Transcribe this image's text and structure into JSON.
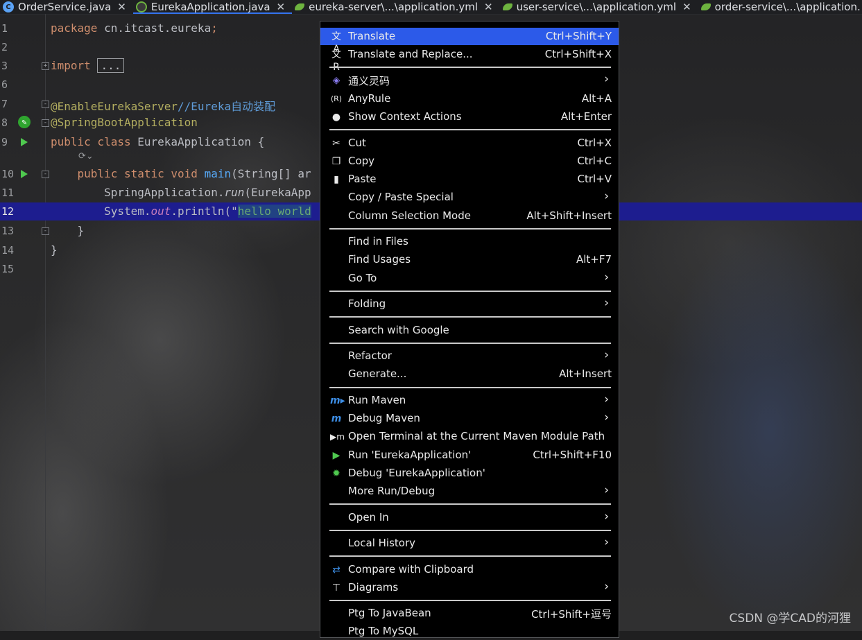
{
  "tabs": [
    {
      "label": "OrderService.java",
      "icon": "class-c-icon",
      "active": false
    },
    {
      "label": "EurekaApplication.java",
      "icon": "spring-class-icon",
      "active": true
    },
    {
      "label": "eureka-server\\...\\application.yml",
      "icon": "spring-leaf-icon",
      "active": false
    },
    {
      "label": "user-service\\...\\application.yml",
      "icon": "spring-leaf-icon",
      "active": false
    },
    {
      "label": "order-service\\...\\application.",
      "icon": "spring-leaf-icon",
      "active": false
    }
  ],
  "editor": {
    "line_numbers": [
      "1",
      "2",
      "3",
      "6",
      "7",
      "8",
      "9",
      "10",
      "11",
      "12",
      "13",
      "14",
      "15"
    ],
    "l1": {
      "kw": "package",
      "rest": " cn.itcast.eureka",
      "semi": ";"
    },
    "l3": {
      "kw": "import",
      "folded": "..."
    },
    "l7": {
      "ann": "@EnableEurekaServer",
      "cmt": "//",
      "cmt2": "Eureka自动装配"
    },
    "l8": {
      "ann": "@SpringBootApplication"
    },
    "l9": {
      "kw": "public class",
      "rest": " EurekaApplication {"
    },
    "l10": {
      "kw": "public static void",
      "fn": "main",
      "rest": "(String[] ar"
    },
    "l11": {
      "pre": "SpringApplication.",
      "fn": "run",
      "rest": "(EurekaApp"
    },
    "l12": {
      "pre": "System.",
      "field": "out",
      "mid": ".println(\"",
      "sel": "hello world"
    },
    "l13": "}",
    "l14": "}"
  },
  "menu": {
    "items": [
      {
        "label": "Translate",
        "shortcut": "Ctrl+Shift+Y",
        "icon": "translate-icon"
      },
      {
        "label": "Translate and Replace...",
        "shortcut": "Ctrl+Shift+X",
        "icon": "translate-replace-icon"
      },
      {
        "label": "通义灵码",
        "icon": "tongyi-icon",
        "submenu": true
      },
      {
        "label": "AnyRule",
        "shortcut": "Alt+A",
        "icon": "regex-icon"
      },
      {
        "label": "Show Context Actions",
        "shortcut": "Alt+Enter",
        "icon": "bulb-icon"
      },
      {
        "label": "Cut",
        "shortcut": "Ctrl+X",
        "icon": "scissors-icon"
      },
      {
        "label": "Copy",
        "shortcut": "Ctrl+C",
        "icon": "copy-icon"
      },
      {
        "label": "Paste",
        "shortcut": "Ctrl+V",
        "icon": "paste-icon"
      },
      {
        "label": "Copy / Paste Special",
        "submenu": true
      },
      {
        "label": "Column Selection Mode",
        "shortcut": "Alt+Shift+Insert"
      },
      {
        "label": "Find in Files"
      },
      {
        "label": "Find Usages",
        "shortcut": "Alt+F7"
      },
      {
        "label": "Go To",
        "submenu": true
      },
      {
        "label": "Folding",
        "submenu": true
      },
      {
        "label": "Search with Google"
      },
      {
        "label": "Refactor",
        "submenu": true
      },
      {
        "label": "Generate...",
        "shortcut": "Alt+Insert"
      },
      {
        "label": "Run Maven",
        "icon": "maven-run-icon",
        "submenu": true
      },
      {
        "label": "Debug Maven",
        "icon": "maven-debug-icon",
        "submenu": true
      },
      {
        "label": "Open Terminal at the Current Maven Module Path",
        "icon": "terminal-maven-icon"
      },
      {
        "label": "Run 'EurekaApplication'",
        "shortcut": "Ctrl+Shift+F10",
        "icon": "run-icon"
      },
      {
        "label": "Debug 'EurekaApplication'",
        "icon": "debug-bug-icon"
      },
      {
        "label": "More Run/Debug",
        "submenu": true
      },
      {
        "label": "Open In",
        "submenu": true
      },
      {
        "label": "Local History",
        "submenu": true
      },
      {
        "label": "Compare with Clipboard",
        "icon": "compare-icon"
      },
      {
        "label": "Diagrams",
        "icon": "diagram-icon",
        "submenu": true
      },
      {
        "label": "Ptg To JavaBean",
        "shortcut": "Ctrl+Shift+逗号"
      },
      {
        "label": "Ptg To MySQL"
      }
    ]
  },
  "watermark": "CSDN @学CAD的河狸",
  "colors": {
    "menu_selection": "#2c5ae9",
    "line_highlight": "#1d1d8f",
    "run_green": "#4fc94f"
  }
}
